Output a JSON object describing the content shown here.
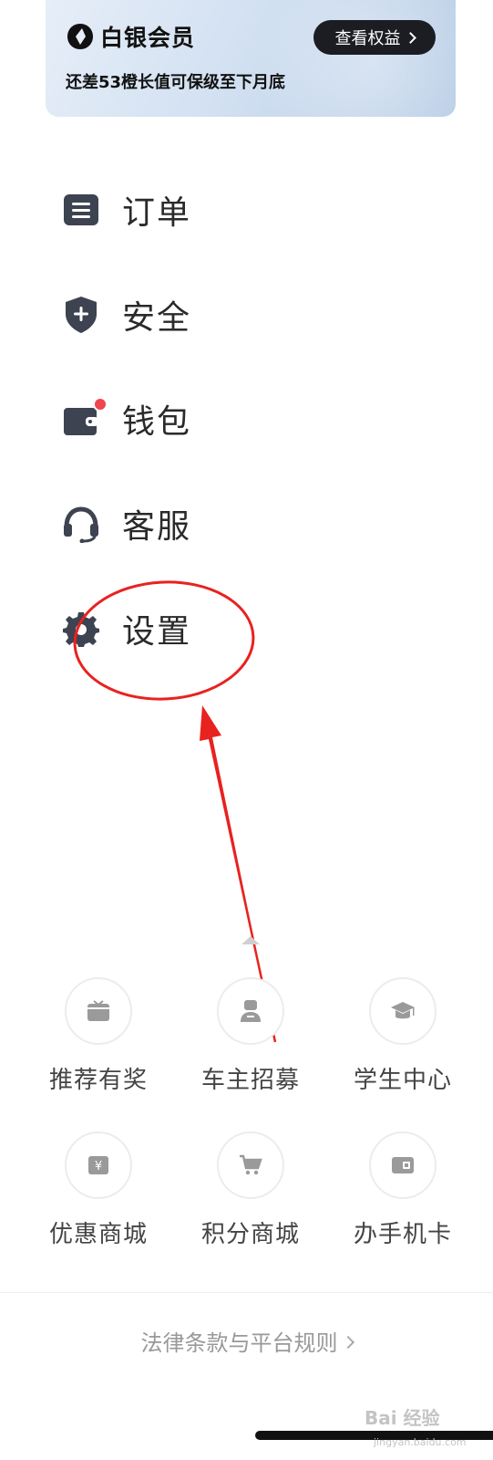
{
  "member": {
    "title": "白银会员",
    "benefits_label": "查看权益",
    "subtitle": "还差53橙长值可保级至下月底"
  },
  "menu": [
    {
      "label": "订单",
      "icon": "order-icon"
    },
    {
      "label": "安全",
      "icon": "shield-plus-icon"
    },
    {
      "label": "钱包",
      "icon": "wallet-icon",
      "badge": true
    },
    {
      "label": "客服",
      "icon": "headset-icon"
    },
    {
      "label": "设置",
      "icon": "gear-icon"
    }
  ],
  "services": [
    {
      "label": "推荐有奖",
      "icon": "gift-icon"
    },
    {
      "label": "车主招募",
      "icon": "driver-icon"
    },
    {
      "label": "学生中心",
      "icon": "graduation-cap-icon"
    },
    {
      "label": "优惠商城",
      "icon": "yen-tag-icon"
    },
    {
      "label": "积分商城",
      "icon": "cart-icon"
    },
    {
      "label": "办手机卡",
      "icon": "sim-card-icon"
    }
  ],
  "footer": {
    "legal_label": "法律条款与平台规则"
  },
  "watermark": {
    "text": "Bai 经验",
    "sub": "jingyan.baidu.com"
  },
  "colors": {
    "icon_dark": "#3d4350",
    "badge_red": "#f0454f",
    "annotation_red": "#e8221f",
    "service_icon_gray": "#9a9a9a"
  }
}
